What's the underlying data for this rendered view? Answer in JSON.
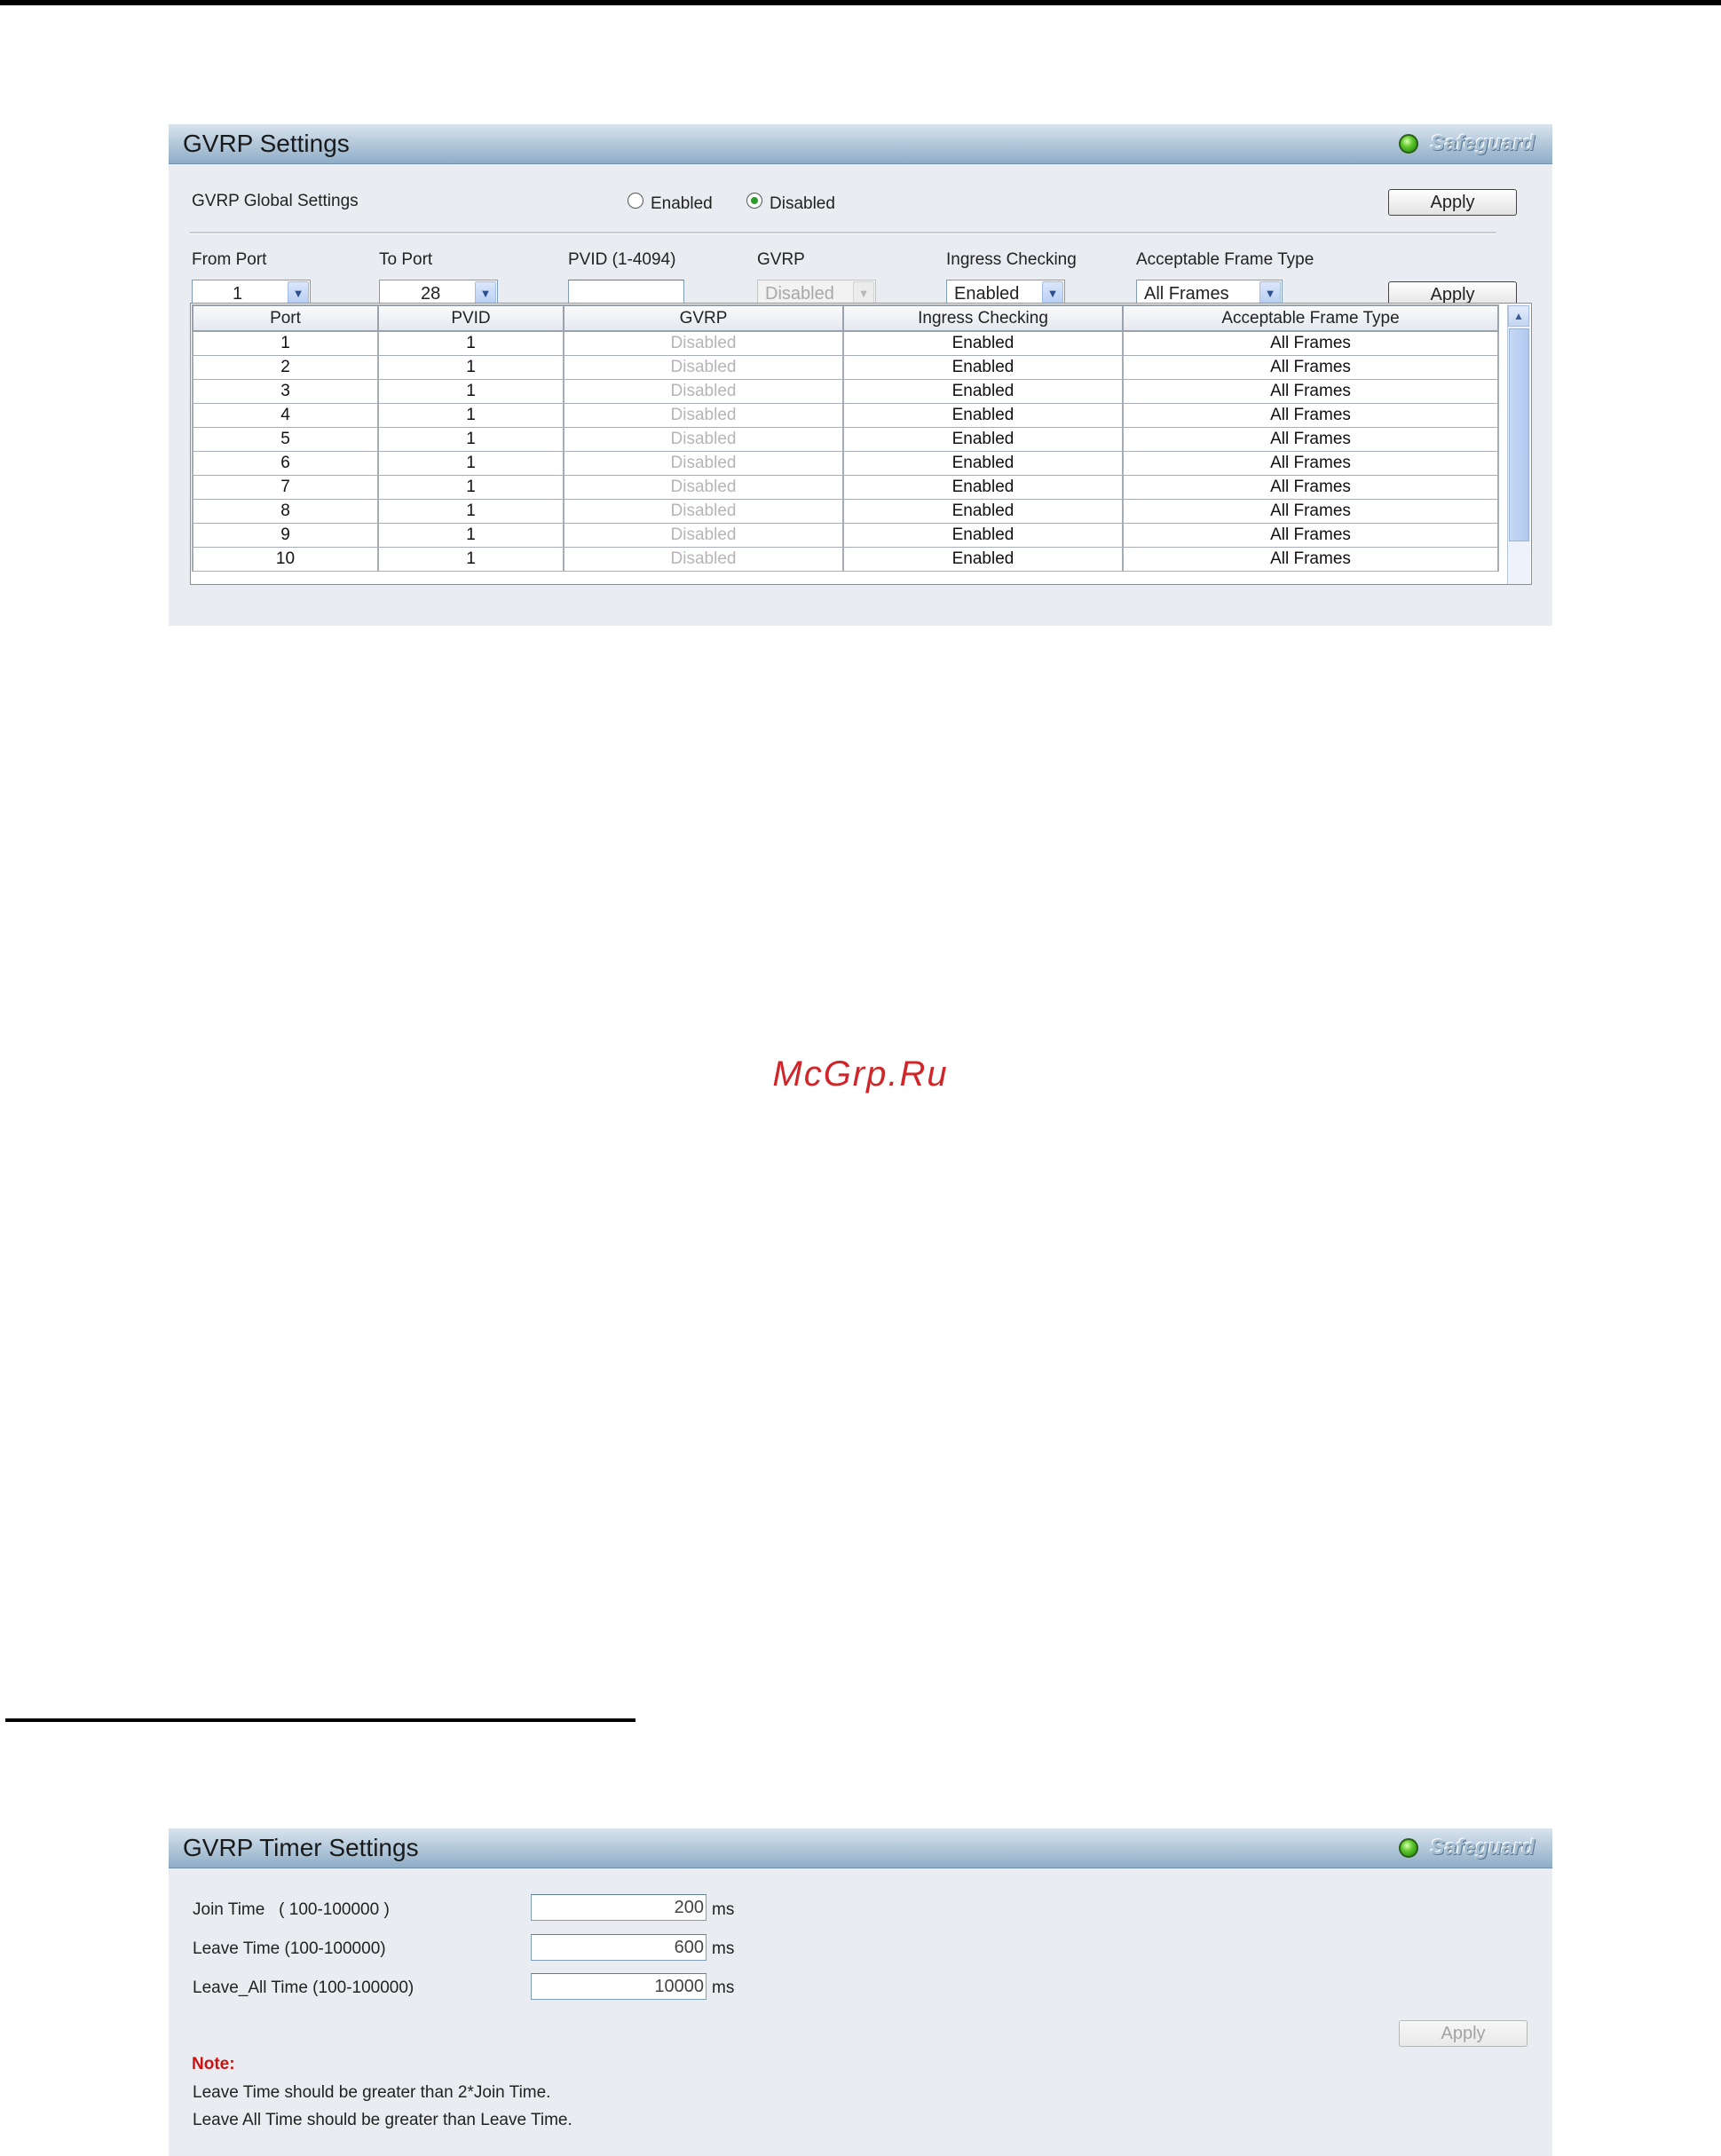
{
  "gvrp_panel": {
    "title": "GVRP Settings",
    "safeguard": "Safeguard",
    "global_label": "GVRP Global Settings",
    "enabled_label": "Enabled",
    "disabled_label": "Disabled",
    "global_selected": "Disabled",
    "apply_label": "Apply",
    "form": {
      "from_port_label": "From Port",
      "from_port_value": "1",
      "to_port_label": "To Port",
      "to_port_value": "28",
      "pvid_label": "PVID (1-4094)",
      "pvid_value": "",
      "gvrp_label": "GVRP",
      "gvrp_value": "Disabled",
      "ingress_label": "Ingress Checking",
      "ingress_value": "Enabled",
      "frame_type_label": "Acceptable Frame Type",
      "frame_type_value": "All Frames"
    },
    "table": {
      "headers": [
        "Port",
        "PVID",
        "GVRP",
        "Ingress Checking",
        "Acceptable Frame Type"
      ],
      "rows": [
        [
          "1",
          "1",
          "Disabled",
          "Enabled",
          "All Frames"
        ],
        [
          "2",
          "1",
          "Disabled",
          "Enabled",
          "All Frames"
        ],
        [
          "3",
          "1",
          "Disabled",
          "Enabled",
          "All Frames"
        ],
        [
          "4",
          "1",
          "Disabled",
          "Enabled",
          "All Frames"
        ],
        [
          "5",
          "1",
          "Disabled",
          "Enabled",
          "All Frames"
        ],
        [
          "6",
          "1",
          "Disabled",
          "Enabled",
          "All Frames"
        ],
        [
          "7",
          "1",
          "Disabled",
          "Enabled",
          "All Frames"
        ],
        [
          "8",
          "1",
          "Disabled",
          "Enabled",
          "All Frames"
        ],
        [
          "9",
          "1",
          "Disabled",
          "Enabled",
          "All Frames"
        ],
        [
          "10",
          "1",
          "Disabled",
          "Enabled",
          "All Frames"
        ]
      ]
    }
  },
  "watermark": "McGrp.Ru",
  "timer_panel": {
    "title": "GVRP Timer Settings",
    "safeguard": "Safeguard",
    "join_label": "Join Time   ( 100-100000 )",
    "join_value": "200",
    "leave_label": "Leave Time (100-100000)",
    "leave_value": "600",
    "leave_all_label": "Leave_All Time (100-100000)",
    "leave_all_value": "10000",
    "unit": "ms",
    "apply_label": "Apply",
    "note_title": "Note:",
    "note_lines": [
      "Leave Time should be greater than 2*Join Time.",
      "Leave All Time should be greater than Leave Time."
    ]
  },
  "colors": {
    "header_gradient_top": "#d9e4ee",
    "header_gradient_bottom": "#8fadc7",
    "panel_bg": "#e9ecf0",
    "status_led": "#5cc82a",
    "note_red": "#cc1111",
    "watermark_red": "#d0262a"
  }
}
